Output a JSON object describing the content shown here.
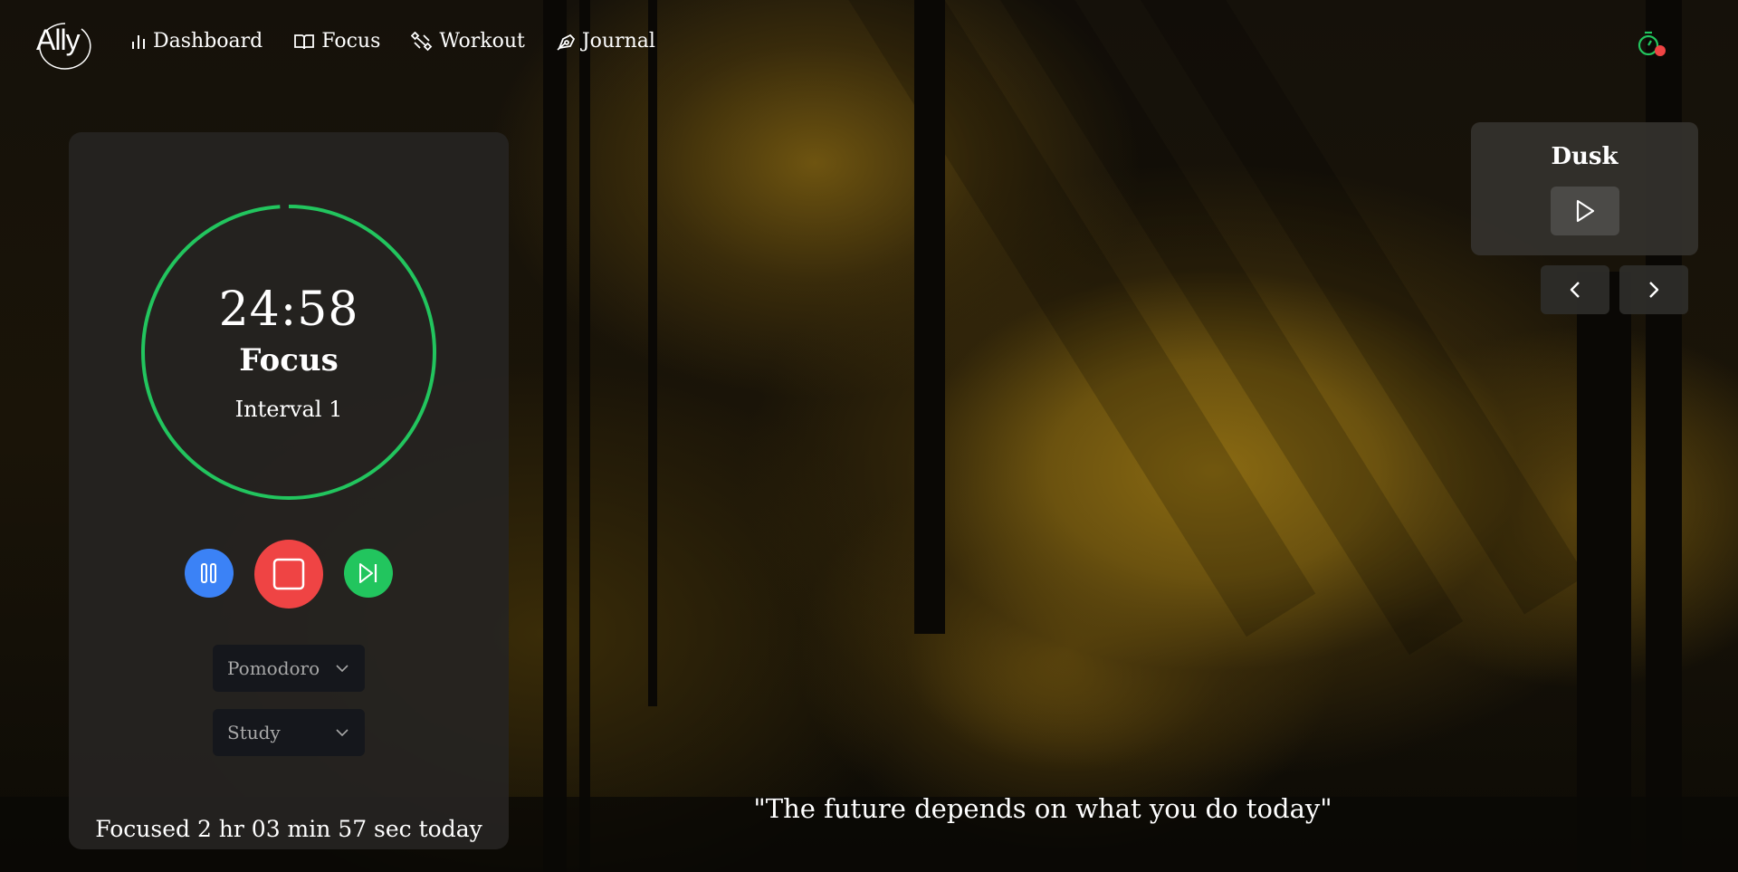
{
  "app": {
    "logo_text": "Ally"
  },
  "nav": {
    "items": [
      {
        "label": "Dashboard",
        "icon": "bar-chart-icon"
      },
      {
        "label": "Focus",
        "icon": "book-open-icon"
      },
      {
        "label": "Workout",
        "icon": "dumbbell-icon"
      },
      {
        "label": "Journal",
        "icon": "pen-tool-icon"
      }
    ]
  },
  "header": {
    "timer_indicator_icon": "stopwatch-icon",
    "indicator_color": "#ef4444"
  },
  "timer": {
    "time": "24:58",
    "mode": "Focus",
    "interval": "Interval 1",
    "progress": 0.99,
    "ring_color": "#22c55e"
  },
  "controls": {
    "pause": {
      "icon": "pause-icon",
      "color": "#3b82f6"
    },
    "stop": {
      "icon": "stop-icon",
      "color": "#ef4444"
    },
    "skip": {
      "icon": "skip-forward-icon",
      "color": "#22c55e"
    }
  },
  "selects": {
    "mode": {
      "value": "Pomodoro"
    },
    "category": {
      "value": "Study"
    }
  },
  "stats": {
    "focused_today": "Focused 2 hr 03 min 57 sec today"
  },
  "scene": {
    "title": "Dusk",
    "play_icon": "play-icon",
    "prev_icon": "chevron-left-icon",
    "next_icon": "chevron-right-icon"
  },
  "quote": "\"The future depends on what you do today\""
}
